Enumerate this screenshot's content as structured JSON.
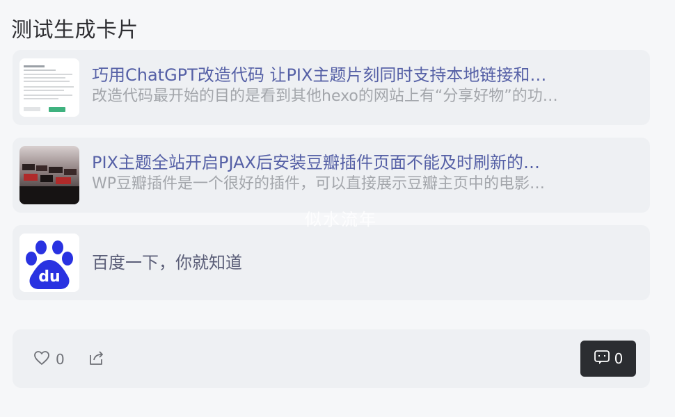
{
  "page": {
    "title": "测试生成卡片"
  },
  "cards": [
    {
      "title": "巧用ChatGPT改造代码 让PIX主题片刻同时支持本地链接和…",
      "description": "改造代码最开始的目的是看到其他hexo的网站上有“分享好物”的功…",
      "thumbnail": "article-screenshot"
    },
    {
      "title": "PIX主题全站开启PJAX后安装豆瓣插件页面不能及时刷新的…",
      "description": "WP豆瓣插件是一个很好的插件，可以直接展示豆瓣主页中的电影…",
      "thumbnail": "photo-thumbnail"
    },
    {
      "title": "百度一下，你就知道",
      "thumbnail": "baidu-logo",
      "logo_text": "du"
    }
  ],
  "watermark": "似水流年",
  "actions": {
    "like_count": "0",
    "comment_count": "0"
  },
  "colors": {
    "title": "#5560a6",
    "desc": "#a3a6ab",
    "baidu_blue": "#2932e1",
    "comment_bg": "#2b2d31"
  }
}
